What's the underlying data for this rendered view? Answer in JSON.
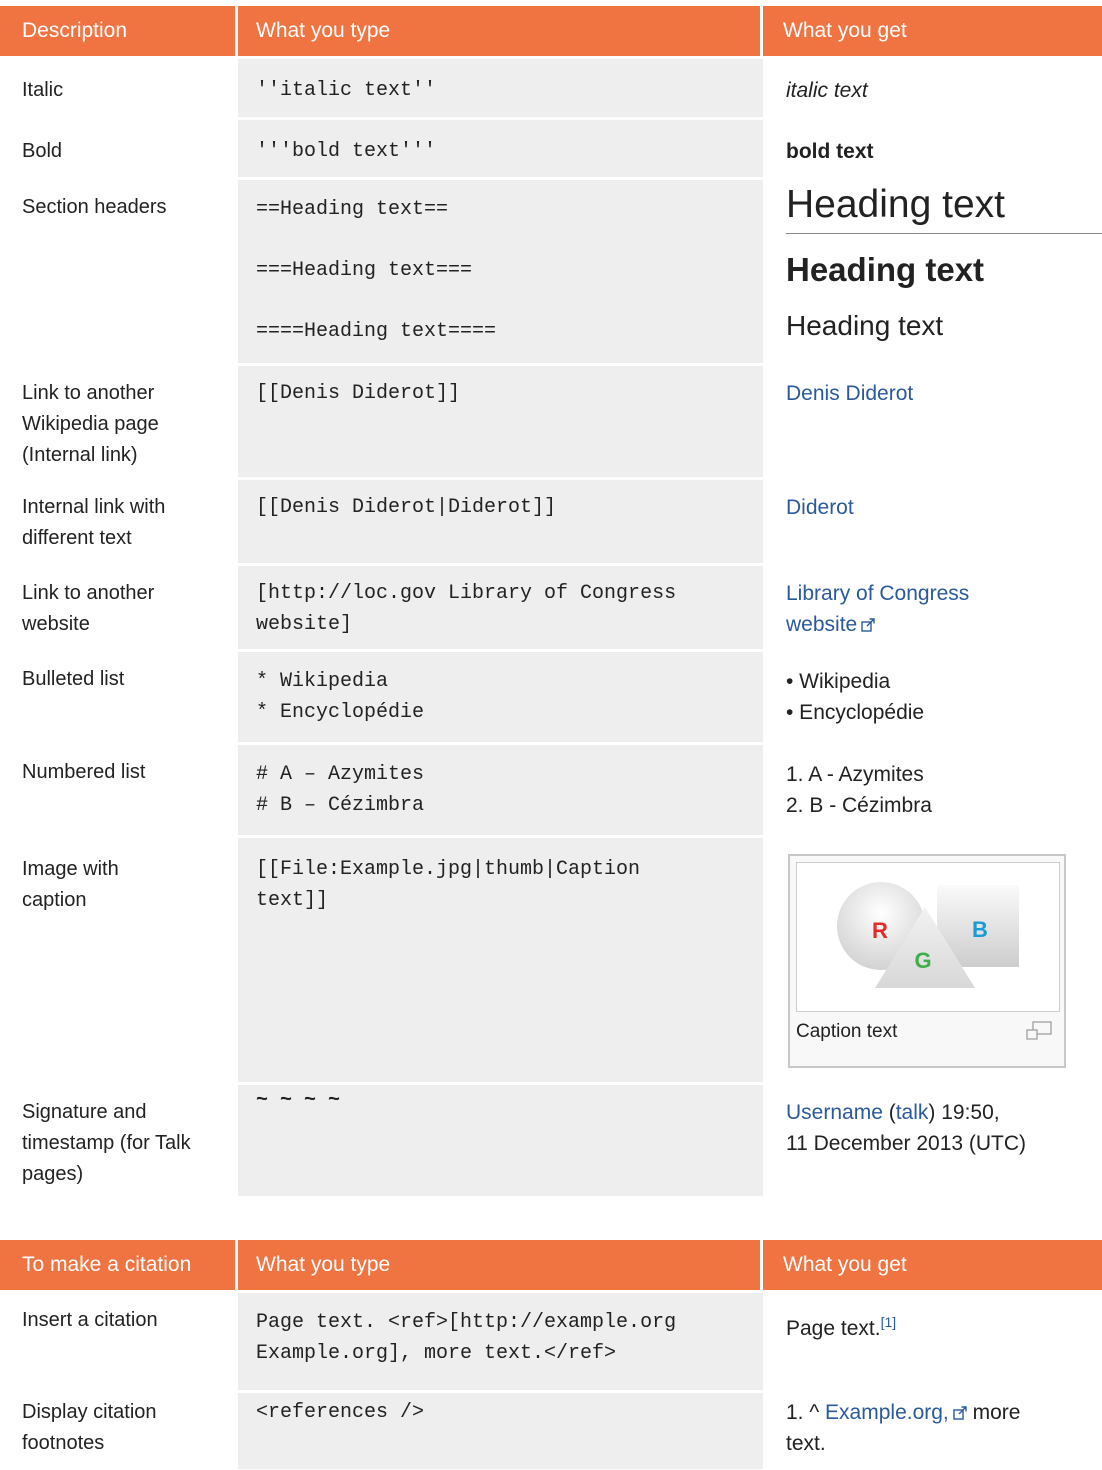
{
  "table1": {
    "headers": [
      "Description",
      "What you type",
      "What you get"
    ],
    "rows": {
      "italic": {
        "desc": "Italic",
        "code": "''italic text''",
        "result": "italic text"
      },
      "bold": {
        "desc": "Bold",
        "code": "'''bold text'''",
        "result": "bold text"
      },
      "headers": {
        "desc": "Section headers",
        "code": [
          "==Heading text==",
          "===Heading text===",
          "====Heading text===="
        ],
        "result": [
          "Heading text",
          "Heading text",
          "Heading text"
        ]
      },
      "internal": {
        "desc": [
          "Link to another",
          "Wikipedia page",
          "(Internal link)"
        ],
        "code": "[[Denis Diderot]]",
        "result": "Denis Diderot"
      },
      "internal_diff": {
        "desc": [
          "Internal link with",
          "different text"
        ],
        "code": "[[Denis Diderot|Diderot]]",
        "result": "Diderot"
      },
      "external": {
        "desc": [
          "Link to another",
          "website"
        ],
        "code": [
          "[http://loc.gov Library of Congress",
          "website]"
        ],
        "result": [
          "Library of Congress",
          "website"
        ]
      },
      "bulleted": {
        "desc": "Bulleted list",
        "code": [
          "* Wikipedia",
          "* Encyclopédie"
        ],
        "result": [
          "• Wikipedia",
          "• Encyclopédie"
        ]
      },
      "numbered": {
        "desc": "Numbered list",
        "code": [
          "# A – Azymites",
          "# B – Cézimbra"
        ],
        "result": [
          "1. A - Azymites",
          "2. B - Cézimbra"
        ]
      },
      "image": {
        "desc": [
          "Image with",
          "caption"
        ],
        "code": [
          "[[File:Example.jpg|thumb|Caption",
          "text]]"
        ],
        "letters": [
          "R",
          "G",
          "B"
        ],
        "caption": "Caption text"
      },
      "signature": {
        "desc": [
          "Signature and",
          "timestamp (for Talk",
          "pages)"
        ],
        "code": "~ ~ ~ ~",
        "user": "Username",
        "talk": "talk",
        "time1": "19:50,",
        "time2": "11 December 2013 (UTC)"
      }
    }
  },
  "table2": {
    "headers": [
      "To make a citation",
      "What you type",
      "What you get"
    ],
    "rows": {
      "insert": {
        "desc": "Insert a citation",
        "code": [
          "Page text. <ref>[http://example.org",
          "Example.org], more text.</ref>"
        ],
        "result": "Page text.",
        "sup": "[1]"
      },
      "display": {
        "desc": [
          "Display citation",
          "footnotes"
        ],
        "code": "<references />",
        "num": "1. ^ ",
        "link": "Example.org,",
        "after1": " more",
        "after2": "text."
      }
    }
  },
  "colors": {
    "header": "#f07442",
    "code_bg": "#eeeeee",
    "link": "#2a5a9c",
    "R": "#e32b2b",
    "G": "#3fae49",
    "B": "#1a9ad6"
  }
}
